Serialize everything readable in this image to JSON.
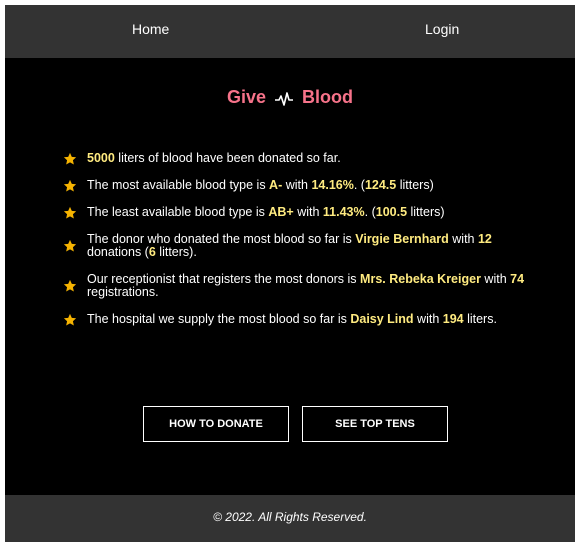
{
  "nav": {
    "home": "Home",
    "login": "Login"
  },
  "brand": {
    "left": "Give",
    "right": "Blood",
    "icon": "heartbeat-icon",
    "color": "#f7738a"
  },
  "highlight_color": "#ffeb80",
  "star_color": "#f5b301",
  "stats": [
    {
      "parts": [
        {
          "t": "5000",
          "b": true
        },
        {
          "t": " liters of blood have been donated so far.",
          "b": false
        }
      ]
    },
    {
      "parts": [
        {
          "t": "The most available blood type is ",
          "b": false
        },
        {
          "t": "A-",
          "b": true
        },
        {
          "t": " with ",
          "b": false
        },
        {
          "t": "14.16%",
          "b": true
        },
        {
          "t": ". (",
          "b": false
        },
        {
          "t": "124.5",
          "b": true
        },
        {
          "t": " litters)",
          "b": false
        }
      ]
    },
    {
      "parts": [
        {
          "t": "The least available blood type is ",
          "b": false
        },
        {
          "t": "AB+",
          "b": true
        },
        {
          "t": " with ",
          "b": false
        },
        {
          "t": "11.43%",
          "b": true
        },
        {
          "t": ". (",
          "b": false
        },
        {
          "t": "100.5",
          "b": true
        },
        {
          "t": " litters)",
          "b": false
        }
      ]
    },
    {
      "parts": [
        {
          "t": "The donor who donated the most blood so far is ",
          "b": false
        },
        {
          "t": "Virgie Bernhard",
          "b": true
        },
        {
          "t": " with ",
          "b": false
        },
        {
          "t": "12",
          "b": true
        },
        {
          "t": " donations (",
          "b": false
        },
        {
          "t": "6",
          "b": true
        },
        {
          "t": " litters).",
          "b": false
        }
      ]
    },
    {
      "parts": [
        {
          "t": "Our receptionist that registers the most donors is ",
          "b": false
        },
        {
          "t": "Mrs. Rebeka Kreiger",
          "b": true
        },
        {
          "t": " with ",
          "b": false
        },
        {
          "t": "74",
          "b": true
        },
        {
          "t": " registrations.",
          "b": false
        }
      ]
    },
    {
      "parts": [
        {
          "t": "The hospital we supply the most blood so far is ",
          "b": false
        },
        {
          "t": "Daisy Lind",
          "b": true
        },
        {
          "t": " with ",
          "b": false
        },
        {
          "t": "194",
          "b": true
        },
        {
          "t": " liters.",
          "b": false
        }
      ]
    }
  ],
  "buttons": {
    "donate": "HOW TO DONATE",
    "top_tens": "SEE TOP TENS"
  },
  "footer": "© 2022. All Rights Reserved."
}
